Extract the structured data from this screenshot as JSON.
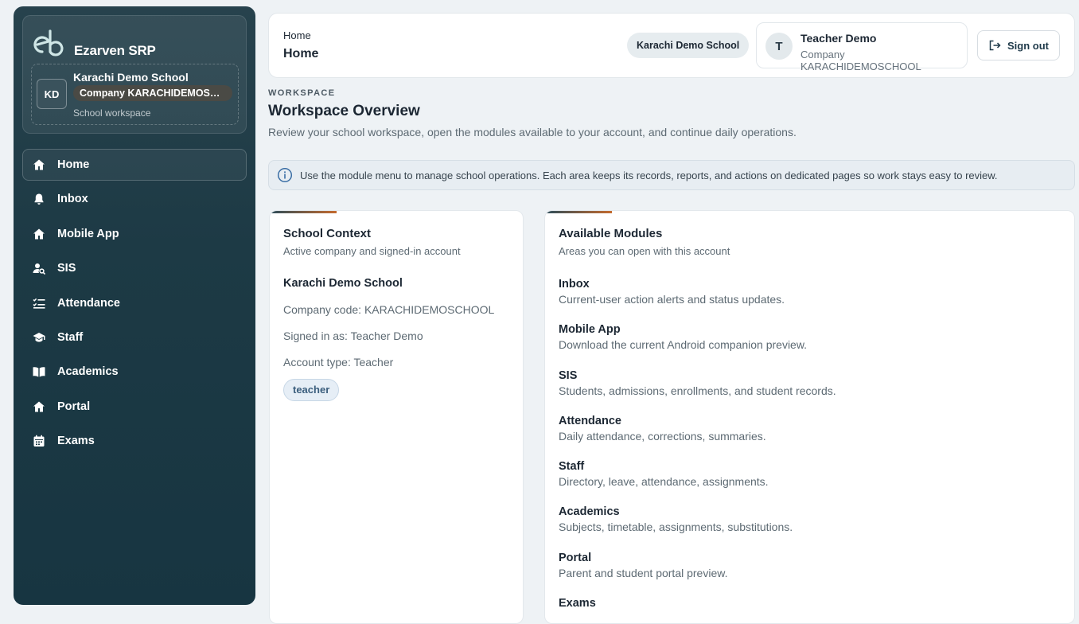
{
  "brand": {
    "name": "Ezarven SRP",
    "logo": "eb-logo"
  },
  "school": {
    "initials": "KD",
    "name": "Karachi Demo School",
    "company_label": "Company KARACHIDEMOSCHOOL",
    "workspace_label": "School workspace"
  },
  "sidebar": {
    "items": [
      {
        "label": "Home",
        "icon": "home-icon",
        "active": true
      },
      {
        "label": "Inbox",
        "icon": "bell-icon",
        "active": false
      },
      {
        "label": "Mobile App",
        "icon": "home-icon",
        "active": false
      },
      {
        "label": "SIS",
        "icon": "user-search-icon",
        "active": false
      },
      {
        "label": "Attendance",
        "icon": "checklist-icon",
        "active": false
      },
      {
        "label": "Staff",
        "icon": "graduation-cap-icon",
        "active": false
      },
      {
        "label": "Academics",
        "icon": "book-icon",
        "active": false
      },
      {
        "label": "Portal",
        "icon": "home-icon",
        "active": false
      },
      {
        "label": "Exams",
        "icon": "calendar-icon",
        "active": false
      }
    ]
  },
  "header": {
    "breadcrumb": "Home",
    "title": "Home",
    "school_chip": "Karachi Demo School",
    "user": {
      "initial": "T",
      "name": "Teacher Demo",
      "company": "Company KARACHIDEMOSCHOOL"
    },
    "signout_label": "Sign out"
  },
  "workspace": {
    "eyebrow": "WORKSPACE",
    "title": "Workspace Overview",
    "description": "Review your school workspace, open the modules available to your account, and continue daily operations.",
    "info": "Use the module menu to manage school operations. Each area keeps its records, reports, and actions on dedicated pages so work stays easy to review."
  },
  "context_card": {
    "title": "School Context",
    "subtitle": "Active company and signed-in account",
    "school_name": "Karachi Demo School",
    "company_code": "Company code: KARACHIDEMOSCHOOL",
    "signed_in_as": "Signed in as: Teacher Demo",
    "account_type": "Account type: Teacher",
    "role_badge": "teacher"
  },
  "modules_card": {
    "title": "Available Modules",
    "subtitle": "Areas you can open with this account",
    "items": [
      {
        "name": "Inbox",
        "desc": "Current-user action alerts and status updates."
      },
      {
        "name": "Mobile App",
        "desc": "Download the current Android companion preview."
      },
      {
        "name": "SIS",
        "desc": "Students, admissions, enrollments, and student records."
      },
      {
        "name": "Attendance",
        "desc": "Daily attendance, corrections, summaries."
      },
      {
        "name": "Staff",
        "desc": "Directory, leave, attendance, assignments."
      },
      {
        "name": "Academics",
        "desc": "Subjects, timetable, assignments, substitutions."
      },
      {
        "name": "Portal",
        "desc": "Parent and student portal preview."
      },
      {
        "name": "Exams",
        "desc": ""
      }
    ]
  },
  "colors": {
    "sidebar_bg": "#1d3a45",
    "accent_teal": "#2b4c5a",
    "accent_orange": "#c46a2e",
    "page_bg": "#eef2f5"
  }
}
